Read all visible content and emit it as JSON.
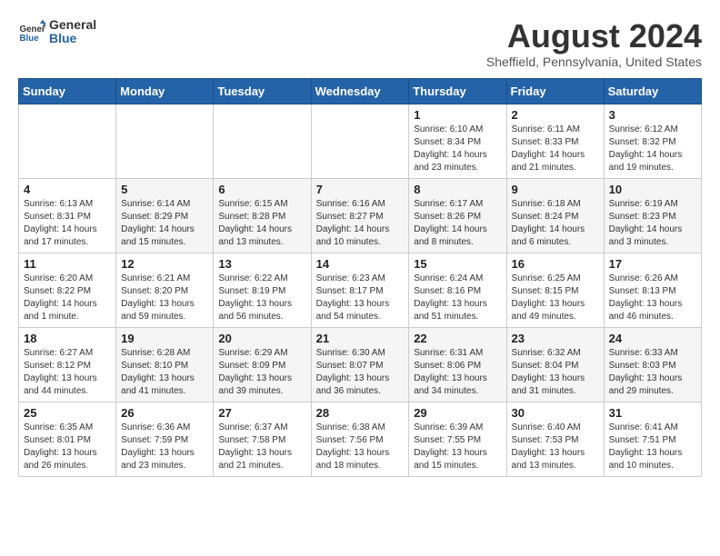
{
  "logo": {
    "text_general": "General",
    "text_blue": "Blue"
  },
  "title": "August 2024",
  "location": "Sheffield, Pennsylvania, United States",
  "weekdays": [
    "Sunday",
    "Monday",
    "Tuesday",
    "Wednesday",
    "Thursday",
    "Friday",
    "Saturday"
  ],
  "weeks": [
    [
      {
        "day": "",
        "info": ""
      },
      {
        "day": "",
        "info": ""
      },
      {
        "day": "",
        "info": ""
      },
      {
        "day": "",
        "info": ""
      },
      {
        "day": "1",
        "info": "Sunrise: 6:10 AM\nSunset: 8:34 PM\nDaylight: 14 hours\nand 23 minutes."
      },
      {
        "day": "2",
        "info": "Sunrise: 6:11 AM\nSunset: 8:33 PM\nDaylight: 14 hours\nand 21 minutes."
      },
      {
        "day": "3",
        "info": "Sunrise: 6:12 AM\nSunset: 8:32 PM\nDaylight: 14 hours\nand 19 minutes."
      }
    ],
    [
      {
        "day": "4",
        "info": "Sunrise: 6:13 AM\nSunset: 8:31 PM\nDaylight: 14 hours\nand 17 minutes."
      },
      {
        "day": "5",
        "info": "Sunrise: 6:14 AM\nSunset: 8:29 PM\nDaylight: 14 hours\nand 15 minutes."
      },
      {
        "day": "6",
        "info": "Sunrise: 6:15 AM\nSunset: 8:28 PM\nDaylight: 14 hours\nand 13 minutes."
      },
      {
        "day": "7",
        "info": "Sunrise: 6:16 AM\nSunset: 8:27 PM\nDaylight: 14 hours\nand 10 minutes."
      },
      {
        "day": "8",
        "info": "Sunrise: 6:17 AM\nSunset: 8:26 PM\nDaylight: 14 hours\nand 8 minutes."
      },
      {
        "day": "9",
        "info": "Sunrise: 6:18 AM\nSunset: 8:24 PM\nDaylight: 14 hours\nand 6 minutes."
      },
      {
        "day": "10",
        "info": "Sunrise: 6:19 AM\nSunset: 8:23 PM\nDaylight: 14 hours\nand 3 minutes."
      }
    ],
    [
      {
        "day": "11",
        "info": "Sunrise: 6:20 AM\nSunset: 8:22 PM\nDaylight: 14 hours\nand 1 minute."
      },
      {
        "day": "12",
        "info": "Sunrise: 6:21 AM\nSunset: 8:20 PM\nDaylight: 13 hours\nand 59 minutes."
      },
      {
        "day": "13",
        "info": "Sunrise: 6:22 AM\nSunset: 8:19 PM\nDaylight: 13 hours\nand 56 minutes."
      },
      {
        "day": "14",
        "info": "Sunrise: 6:23 AM\nSunset: 8:17 PM\nDaylight: 13 hours\nand 54 minutes."
      },
      {
        "day": "15",
        "info": "Sunrise: 6:24 AM\nSunset: 8:16 PM\nDaylight: 13 hours\nand 51 minutes."
      },
      {
        "day": "16",
        "info": "Sunrise: 6:25 AM\nSunset: 8:15 PM\nDaylight: 13 hours\nand 49 minutes."
      },
      {
        "day": "17",
        "info": "Sunrise: 6:26 AM\nSunset: 8:13 PM\nDaylight: 13 hours\nand 46 minutes."
      }
    ],
    [
      {
        "day": "18",
        "info": "Sunrise: 6:27 AM\nSunset: 8:12 PM\nDaylight: 13 hours\nand 44 minutes."
      },
      {
        "day": "19",
        "info": "Sunrise: 6:28 AM\nSunset: 8:10 PM\nDaylight: 13 hours\nand 41 minutes."
      },
      {
        "day": "20",
        "info": "Sunrise: 6:29 AM\nSunset: 8:09 PM\nDaylight: 13 hours\nand 39 minutes."
      },
      {
        "day": "21",
        "info": "Sunrise: 6:30 AM\nSunset: 8:07 PM\nDaylight: 13 hours\nand 36 minutes."
      },
      {
        "day": "22",
        "info": "Sunrise: 6:31 AM\nSunset: 8:06 PM\nDaylight: 13 hours\nand 34 minutes."
      },
      {
        "day": "23",
        "info": "Sunrise: 6:32 AM\nSunset: 8:04 PM\nDaylight: 13 hours\nand 31 minutes."
      },
      {
        "day": "24",
        "info": "Sunrise: 6:33 AM\nSunset: 8:03 PM\nDaylight: 13 hours\nand 29 minutes."
      }
    ],
    [
      {
        "day": "25",
        "info": "Sunrise: 6:35 AM\nSunset: 8:01 PM\nDaylight: 13 hours\nand 26 minutes."
      },
      {
        "day": "26",
        "info": "Sunrise: 6:36 AM\nSunset: 7:59 PM\nDaylight: 13 hours\nand 23 minutes."
      },
      {
        "day": "27",
        "info": "Sunrise: 6:37 AM\nSunset: 7:58 PM\nDaylight: 13 hours\nand 21 minutes."
      },
      {
        "day": "28",
        "info": "Sunrise: 6:38 AM\nSunset: 7:56 PM\nDaylight: 13 hours\nand 18 minutes."
      },
      {
        "day": "29",
        "info": "Sunrise: 6:39 AM\nSunset: 7:55 PM\nDaylight: 13 hours\nand 15 minutes."
      },
      {
        "day": "30",
        "info": "Sunrise: 6:40 AM\nSunset: 7:53 PM\nDaylight: 13 hours\nand 13 minutes."
      },
      {
        "day": "31",
        "info": "Sunrise: 6:41 AM\nSunset: 7:51 PM\nDaylight: 13 hours\nand 10 minutes."
      }
    ]
  ]
}
